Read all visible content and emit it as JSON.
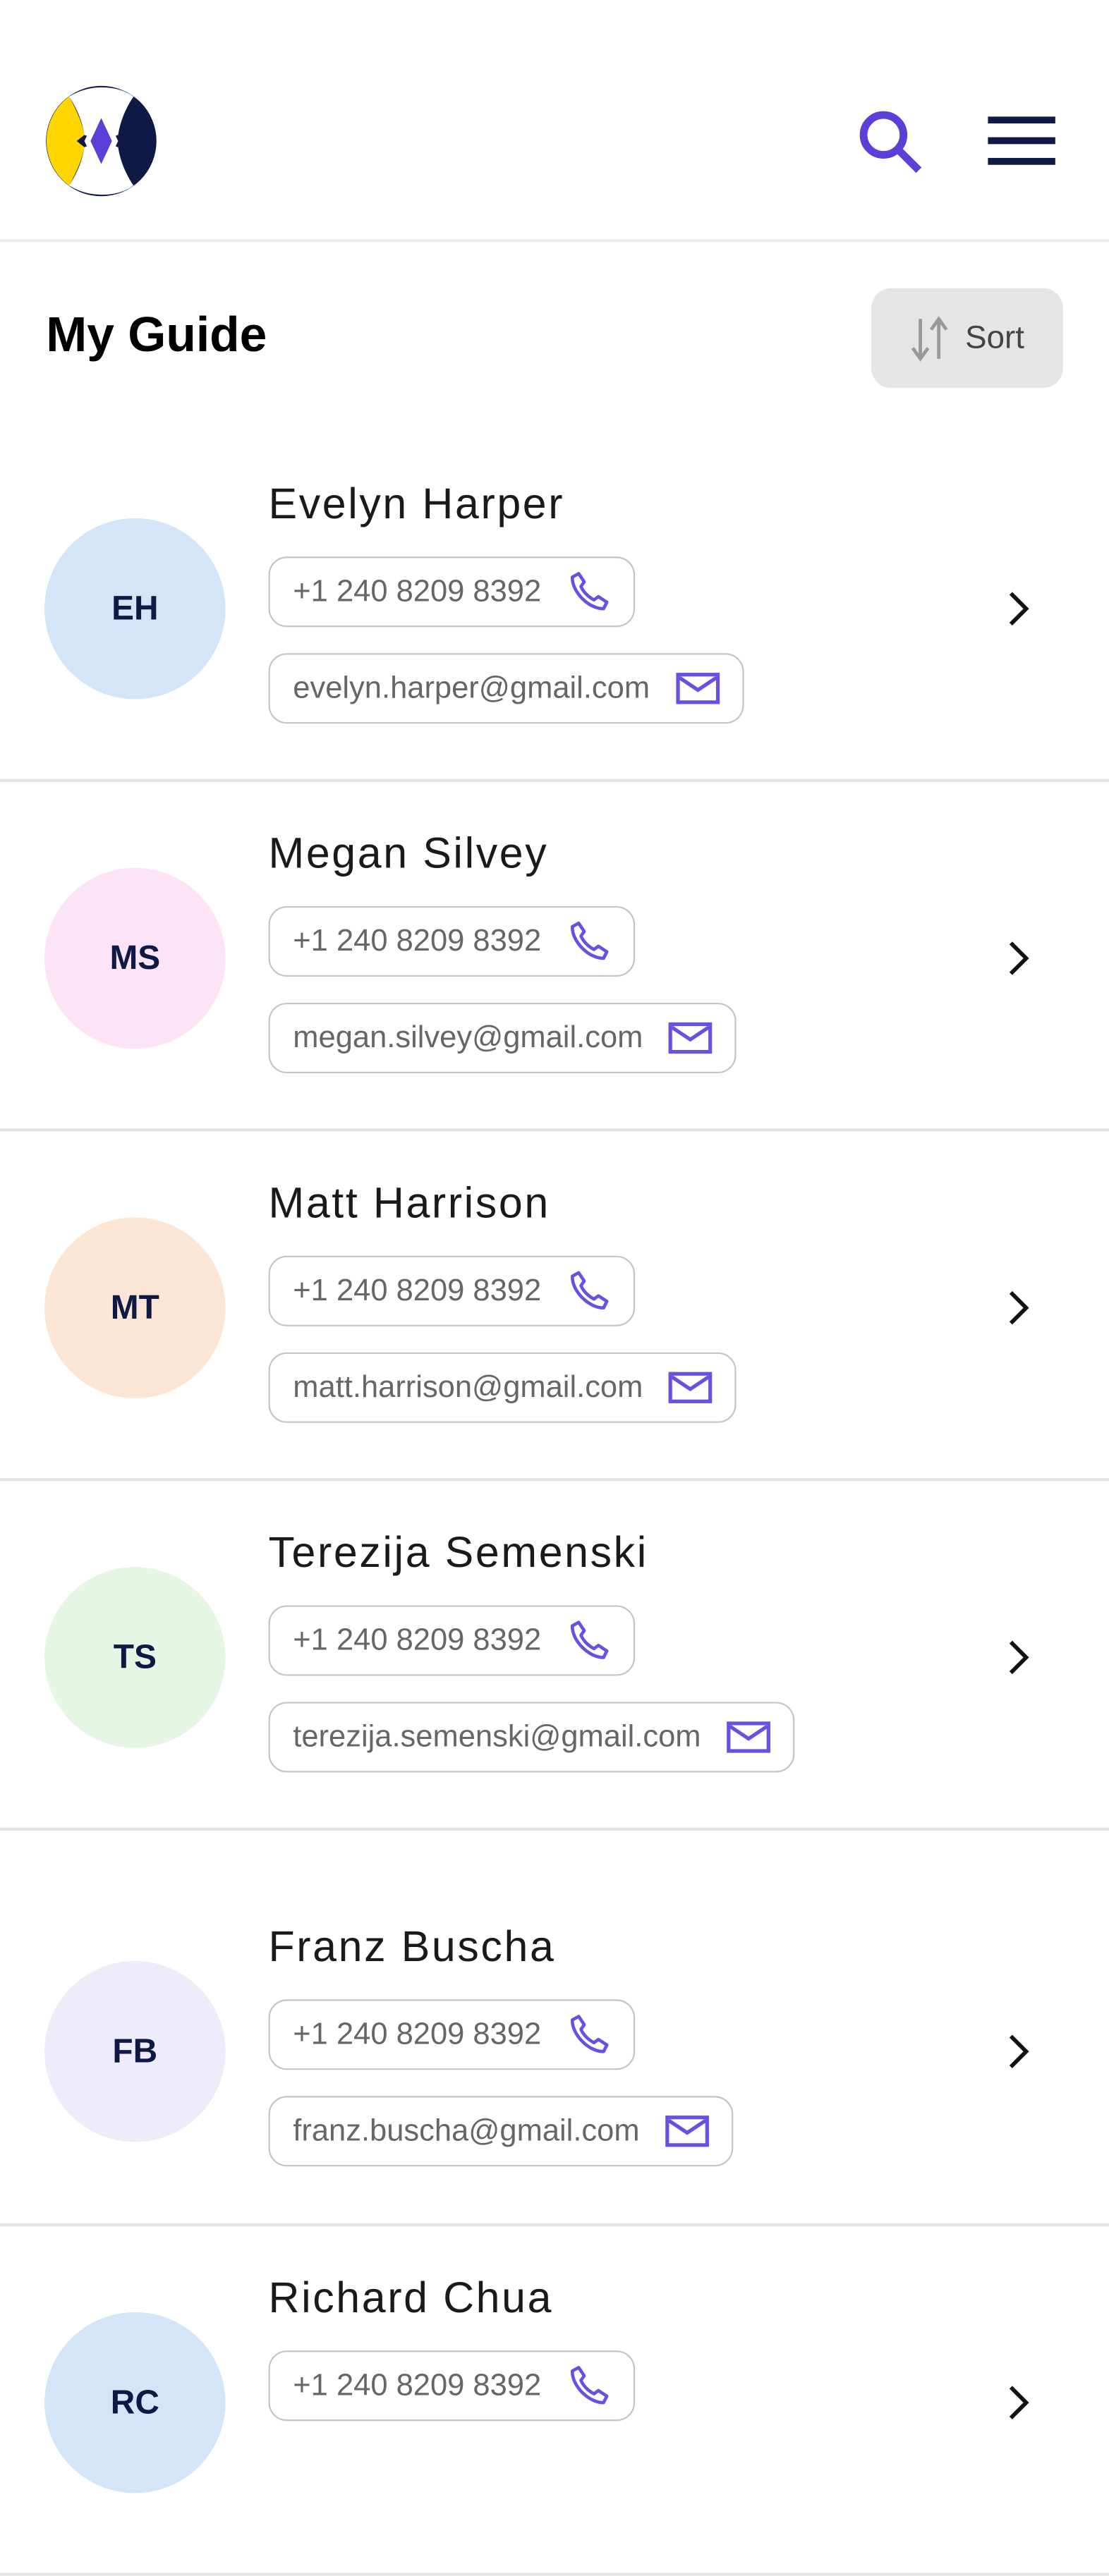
{
  "header": {
    "logo": "app-logo",
    "search_icon": "search-icon",
    "menu_icon": "hamburger-menu-icon"
  },
  "page": {
    "title": "My Guide",
    "sort_label": "Sort"
  },
  "colors": {
    "accent": "#5b3fd6",
    "navy": "#0e1a45",
    "yellow": "#ffd600"
  },
  "contacts": [
    {
      "initials": "EH",
      "name": "Evelyn Harper",
      "phone": "+1 240 8209 8392",
      "email": "evelyn.harper@gmail.com",
      "avatar_color": "#d5e5f8"
    },
    {
      "initials": "MS",
      "name": "Megan Silvey",
      "phone": "+1 240 8209 8392",
      "email": "megan.silvey@gmail.com",
      "avatar_color": "#fce4f6"
    },
    {
      "initials": "MT",
      "name": "Matt Harrison",
      "phone": "+1 240 8209 8392",
      "email": "matt.harrison@gmail.com",
      "avatar_color": "#fbe6d5"
    },
    {
      "initials": "TS",
      "name": "Terezija Semenski",
      "phone": "+1 240 8209 8392",
      "email": "terezija.semenski@gmail.com",
      "avatar_color": "#e6f6e4"
    },
    {
      "initials": "FB",
      "name": "Franz Buscha",
      "phone": "+1 240 8209 8392",
      "email": "franz.buscha@gmail.com",
      "avatar_color": "#eeecfb"
    },
    {
      "initials": "RC",
      "name": "Richard Chua",
      "phone": "+1 240 8209 8392",
      "email": "",
      "avatar_color": "#d5e5f8"
    }
  ]
}
